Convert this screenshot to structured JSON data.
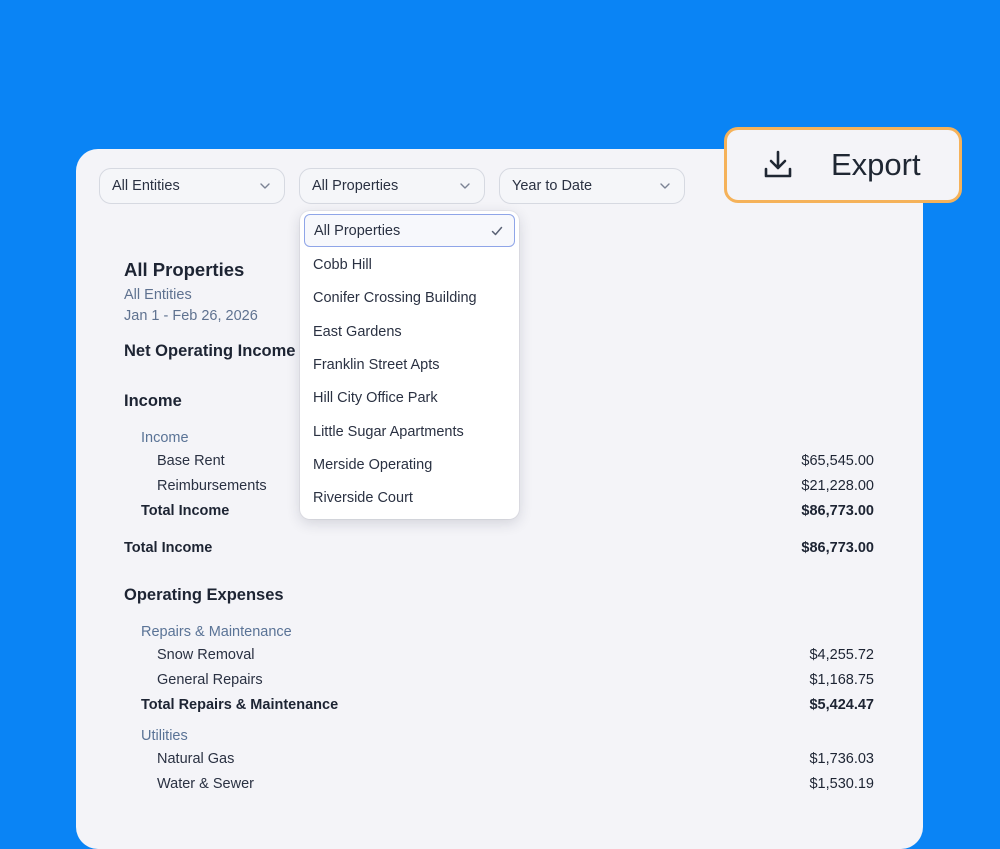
{
  "filters": {
    "entities": "All Entities",
    "properties": "All Properties",
    "period": "Year to Date"
  },
  "export": {
    "label": "Export",
    "icon": "download-icon"
  },
  "dropdown": {
    "selected": "All Properties",
    "items": [
      "All Properties",
      "Cobb Hill",
      "Conifer Crossing Building",
      "East Gardens",
      "Franklin Street Apts",
      "Hill City Office Park",
      "Little Sugar Apartments",
      "Merside Operating",
      "Riverside Court"
    ]
  },
  "report": {
    "title": "All Properties",
    "entities": "All Entities",
    "date_range": "Jan 1 - Feb 26, 2026",
    "report_name": "Net Operating Income",
    "income": {
      "heading": "Income",
      "category": "Income",
      "lines": [
        {
          "label": "Base Rent",
          "amount": "$65,545.00"
        },
        {
          "label": "Reimbursements",
          "amount": "$21,228.00"
        }
      ],
      "subtotal_label": "Total Income",
      "subtotal_amount": "$86,773.00",
      "total_label": "Total Income",
      "total_amount": "$86,773.00"
    },
    "expenses": {
      "heading": "Operating Expenses",
      "repairs": {
        "category": "Repairs & Maintenance",
        "lines": [
          {
            "label": "Snow Removal",
            "amount": "$4,255.72"
          },
          {
            "label": "General Repairs",
            "amount": "$1,168.75"
          }
        ],
        "total_label": "Total Repairs & Maintenance",
        "total_amount": "$5,424.47"
      },
      "utilities": {
        "category": "Utilities",
        "lines": [
          {
            "label": "Natural Gas",
            "amount": "$1,736.03"
          },
          {
            "label": "Water & Sewer",
            "amount": "$1,530.19"
          }
        ]
      }
    }
  },
  "colors": {
    "background": "#0a84f5",
    "card": "#f4f4f8",
    "export_border": "#f5b25a",
    "selected_border": "#8fa5e8",
    "category_text": "#5a7396"
  }
}
